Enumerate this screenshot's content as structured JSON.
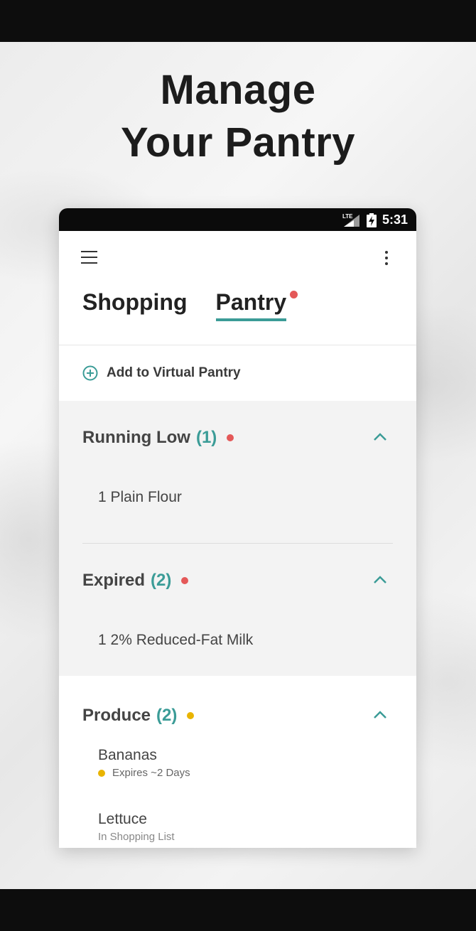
{
  "headline": {
    "line1": "Manage",
    "line2": "Your Pantry"
  },
  "status_bar": {
    "network": "LTE",
    "time": "5:31"
  },
  "tabs": [
    {
      "label": "Shopping",
      "active": false
    },
    {
      "label": "Pantry",
      "active": true,
      "has_notification_dot": true
    }
  ],
  "add_pantry": {
    "label": "Add to Virtual Pantry"
  },
  "sections": {
    "running_low": {
      "title": "Running Low",
      "count": "(1)",
      "dot_color": "#e45858",
      "items": [
        {
          "label": "1 Plain Flour"
        }
      ]
    },
    "expired": {
      "title": "Expired",
      "count": "(2)",
      "dot_color": "#e45858",
      "items": [
        {
          "label": "1 2% Reduced-Fat Milk"
        }
      ]
    },
    "produce": {
      "title": "Produce",
      "count": "(2)",
      "dot_color": "#e9b400",
      "items": [
        {
          "label": "Bananas",
          "sub": "Expires ~2 Days"
        },
        {
          "label": "Lettuce",
          "sub": "In Shopping List"
        }
      ]
    }
  },
  "colors": {
    "accent": "#3b9c97",
    "alert": "#e45858",
    "warning": "#e9b400"
  }
}
